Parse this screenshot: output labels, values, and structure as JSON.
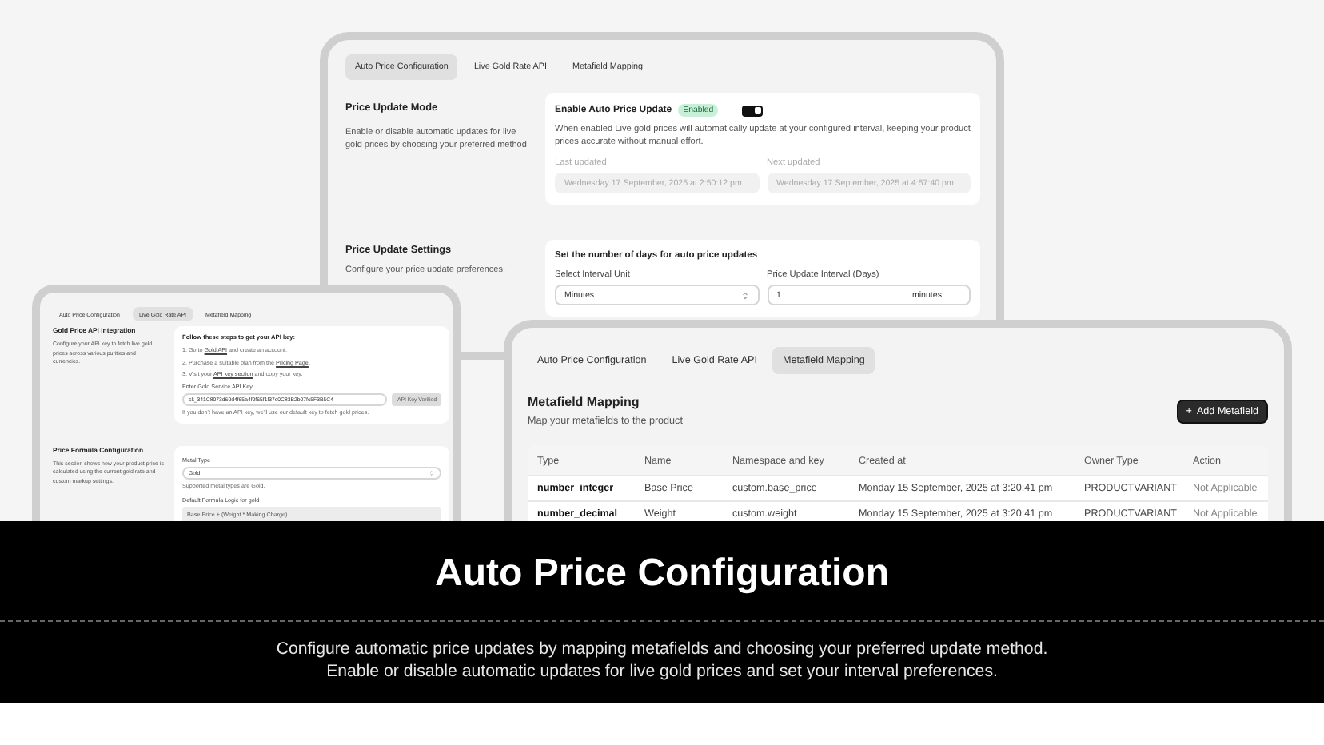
{
  "auto_window": {
    "tabs": [
      {
        "label": "Auto Price Configuration",
        "selected": true
      },
      {
        "label": "Live Gold Rate API",
        "selected": false
      },
      {
        "label": "Metafield Mapping",
        "selected": false
      }
    ],
    "mode_section": {
      "title": "Price Update Mode",
      "description": "Enable or disable automatic updates for live gold prices by choosing your preferred method"
    },
    "enable_card": {
      "label": "Enable Auto Price Update",
      "badge": "Enabled",
      "toggle_on": true,
      "description": "When enabled Live gold prices will automatically update at your configured interval, keeping your product prices accurate without manual effort.",
      "last_updated_label": "Last updated",
      "last_updated_value": "Wednesday 17 September, 2025 at 2:50:12 pm",
      "next_updated_label": "Next updated",
      "next_updated_value": "Wednesday 17 September, 2025 at 4:57:40 pm"
    },
    "settings_section": {
      "title": "Price Update Settings",
      "description": "Configure your price update preferences."
    },
    "interval_card": {
      "title": "Set the number of days for auto price updates",
      "unit_label": "Select Interval Unit",
      "unit_value": "Minutes",
      "interval_label": "Price Update Interval (Days)",
      "interval_value": "1",
      "interval_suffix": "minutes"
    }
  },
  "api_window": {
    "tabs": [
      {
        "label": "Auto Price Configuration",
        "selected": false
      },
      {
        "label": "Live Gold Rate API",
        "selected": true
      },
      {
        "label": "Metafield Mapping",
        "selected": false
      }
    ],
    "api_section": {
      "title": "Gold Price API Integration",
      "description": "Configure your API key to fetch live gold prices across various purities and currencies."
    },
    "api_card": {
      "title": "Follow these steps to get your API key:",
      "steps": [
        {
          "prefix": "1. Go to ",
          "link": "Gold API",
          "suffix": " and create an account."
        },
        {
          "prefix": "2. Purchase a suitable plan from the ",
          "link": "Pricing Page",
          "suffix": "."
        },
        {
          "prefix": "3. Visit your ",
          "link": "API key section",
          "suffix": " and copy your key."
        }
      ],
      "key_label": "Enter Gold Service API Key",
      "key_value": "sk_341C8073d60d4f65a4f0f65f1f37c0C83B2b07fc5F3B5C4",
      "verify_button": "API Key Verified",
      "hint": "If you don't have an API key, we'll use our default key to fetch gold prices."
    },
    "formula_section": {
      "title": "Price Formula Configuration",
      "description": "This section shows how your product price is calculated using the current gold rate and custom markup settings."
    },
    "formula_card": {
      "metal_label": "Metal Type",
      "metal_value": "Gold",
      "metal_hint": "Supported metal types are Gold.",
      "formula_label": "Default Formula Logic for gold",
      "formula_value": "Base Price + (Weight * Making Charge)"
    }
  },
  "metafield_window": {
    "tabs": [
      {
        "label": "Auto Price Configuration",
        "selected": false
      },
      {
        "label": "Live Gold Rate API",
        "selected": false
      },
      {
        "label": "Metafield Mapping",
        "selected": true
      }
    ],
    "title": "Metafield Mapping",
    "subtitle": "Map your metafields to the product",
    "add_button": {
      "icon": "+",
      "label": "Add Metafield"
    },
    "table": {
      "columns": [
        "Type",
        "Name",
        "Namespace and key",
        "Created at",
        "Owner Type",
        "Action"
      ],
      "rows": [
        {
          "cells": [
            "number_integer",
            "Base Price",
            "custom.base_price",
            "Monday 15 September, 2025 at 3:20:41 pm",
            "PRODUCTVARIANT",
            "Not Applicable"
          ]
        },
        {
          "cells": [
            "number_decimal",
            "Weight",
            "custom.weight",
            "Monday 15 September, 2025 at 3:20:41 pm",
            "PRODUCTVARIANT",
            "Not Applicable"
          ]
        }
      ]
    }
  },
  "banner": {
    "title": "Auto Price Configuration",
    "description": [
      "Configure automatic price updates by mapping metafields and choosing your preferred update method.",
      "Enable or disable automatic updates for live gold prices and set your interval preferences."
    ]
  }
}
